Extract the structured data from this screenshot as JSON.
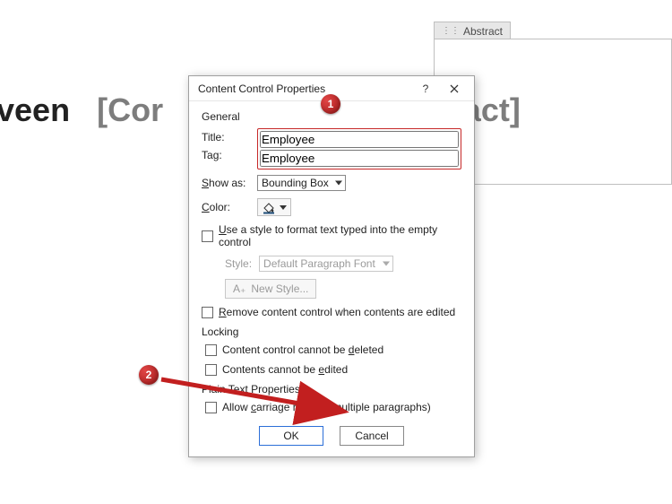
{
  "background": {
    "left_text_black": "veen",
    "left_text_gray_1": "[Cor",
    "right_text_gray": "Abstract]",
    "cc_tab_label": "Abstract"
  },
  "dialog": {
    "title": "Content Control Properties",
    "sections": {
      "general": "General",
      "locking": "Locking",
      "plaintext": "Plain Text Properties"
    },
    "labels": {
      "title": "Title:",
      "tag": "Tag:",
      "show_as": "Show as:",
      "color": "Color:",
      "style": "Style:"
    },
    "values": {
      "title": "Employee",
      "tag": "Employee",
      "show_as": "Bounding Box",
      "style_value": "Default Paragraph Font",
      "color_hex": "#1f4e79"
    },
    "checkboxes": {
      "use_style": "Use a style to format text typed into the empty control",
      "new_style": "New Style...",
      "remove_on_edit": "Remove content control when contents are edited",
      "cannot_delete": "Content control cannot be deleted",
      "cannot_edit": "Contents cannot be edited",
      "carriage_returns": "Allow carriage returns (multiple paragraphs)"
    },
    "buttons": {
      "ok": "OK",
      "cancel": "Cancel"
    }
  },
  "callouts": {
    "one": "1",
    "two": "2"
  }
}
